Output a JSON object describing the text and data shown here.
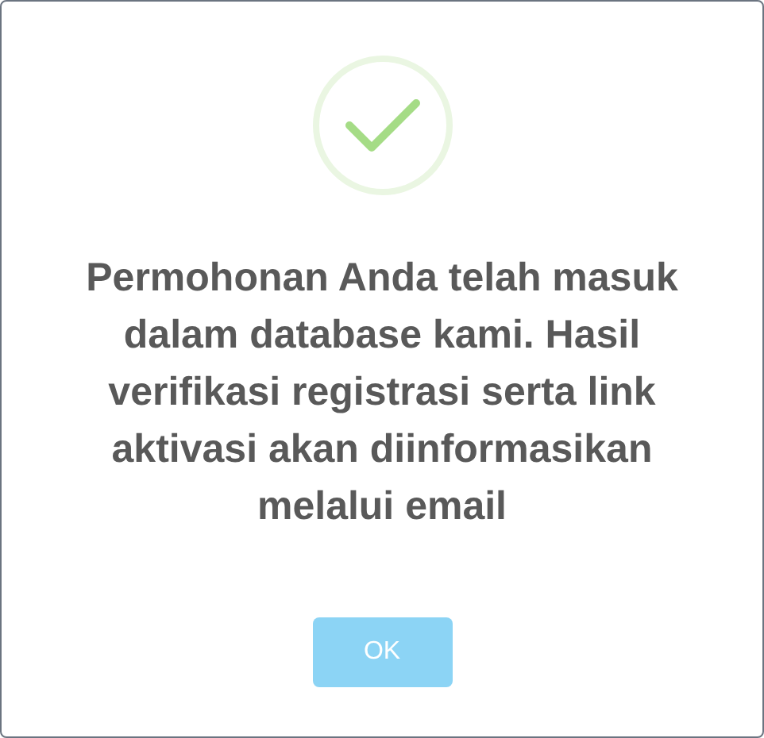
{
  "dialog": {
    "icon": {
      "kind": "success"
    },
    "message": "Permohonan Anda telah masuk dalam database kami. Hasil verifikasi registrasi serta link aktivasi akan diinformasikan melalui email",
    "buttons": [
      {
        "label": "OK"
      }
    ]
  }
}
